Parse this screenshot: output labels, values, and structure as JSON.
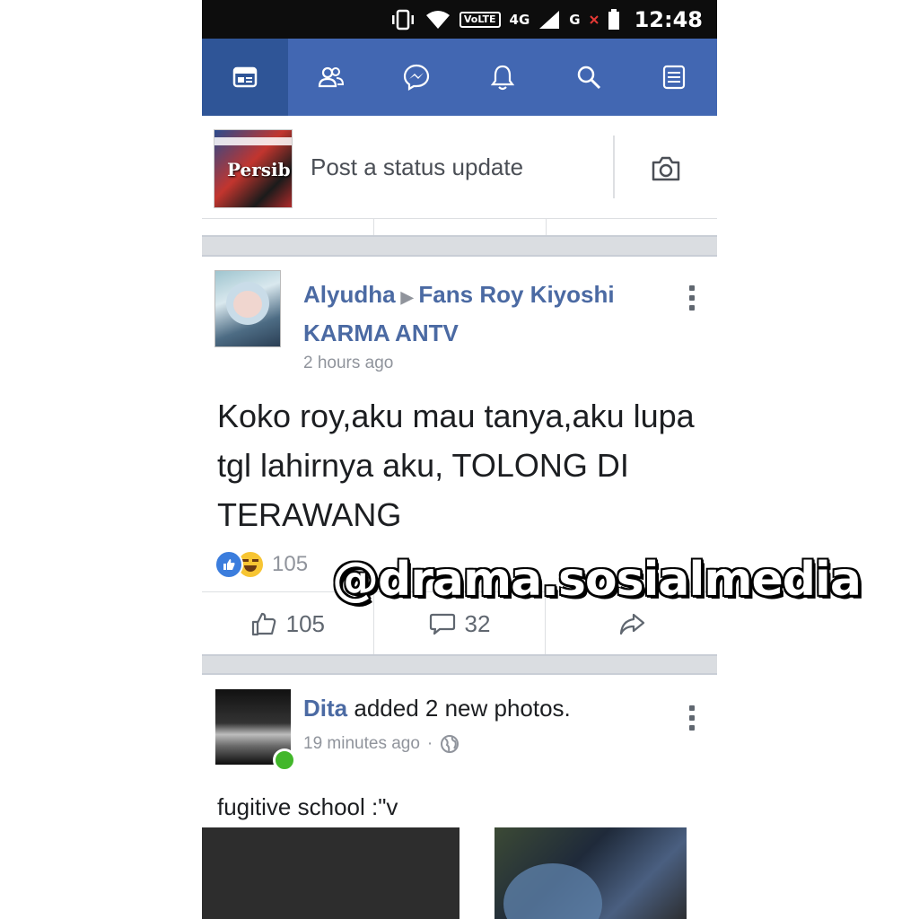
{
  "statusbar": {
    "volte_label": "VoLTE",
    "network_label": "4G",
    "secondary_signal_label": "G",
    "time": "12:48"
  },
  "navbar": {
    "accent_color": "#4267b2",
    "items": [
      {
        "icon": "news-feed-icon",
        "active": true
      },
      {
        "icon": "friends-icon"
      },
      {
        "icon": "messenger-icon"
      },
      {
        "icon": "bell-icon"
      },
      {
        "icon": "search-icon"
      },
      {
        "icon": "menu-icon"
      }
    ]
  },
  "composer": {
    "placeholder": "Post a status update",
    "avatar_text": "Persib",
    "camera_icon": "camera-icon"
  },
  "post1": {
    "author": "Alyudha",
    "target": "Fans Roy Kiyoshi KARMA ANTV",
    "time": "2 hours ago",
    "text": "Koko roy,aku mau tanya,aku lupa tgl lahirnya aku, TOLONG DI TERAWANG",
    "reaction_count": "105",
    "like_count": "105",
    "comment_count": "32"
  },
  "post2": {
    "author": "Dita",
    "action": "added 2 new photos.",
    "time": "19 minutes ago",
    "text": "fugitive school :\"v"
  },
  "watermark": "@drama.sosialmedia"
}
